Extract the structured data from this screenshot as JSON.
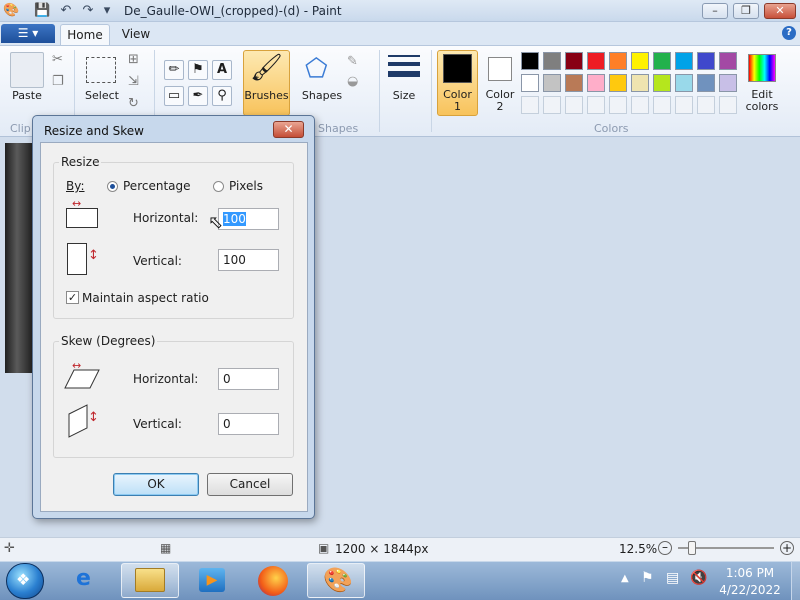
{
  "window": {
    "title": "De_Gaulle-OWI_(cropped)-(d) - Paint",
    "minimize": "–",
    "maximize": "❐",
    "close": "✕"
  },
  "ribbon_tabs": {
    "file": "☰ ▾",
    "home": "Home",
    "view": "View",
    "help": "?"
  },
  "ribbon": {
    "clipboard": {
      "paste": "Paste",
      "group": "Clip"
    },
    "image": {
      "select": "Select"
    },
    "brushes": "Brushes",
    "shapes": {
      "label": "Shapes",
      "group": "Shapes"
    },
    "size": "Size",
    "color1": [
      "Color",
      "1"
    ],
    "color2": [
      "Color",
      "2"
    ],
    "edit_colors": [
      "Edit",
      "colors"
    ],
    "colors_group": "Colors",
    "palette_row1": [
      "#000000",
      "#7f7f7f",
      "#880015",
      "#ed1c24",
      "#ff7f27",
      "#fff200",
      "#22b14c",
      "#00a2e8",
      "#3f48cc",
      "#a349a4"
    ],
    "palette_row2": [
      "#ffffff",
      "#c3c3c3",
      "#b97a57",
      "#ffaec9",
      "#ffc90e",
      "#efe4b0",
      "#b5e61d",
      "#99d9ea",
      "#7092be",
      "#c8bfe7"
    ],
    "empty_swatches": 10
  },
  "dialog": {
    "title": "Resize and Skew",
    "close": "✕",
    "resize": {
      "legend": "Resize",
      "by_label": "By:",
      "percentage": "Percentage",
      "pixels": "Pixels",
      "horizontal_label": "Horizontal:",
      "horizontal_value": "100",
      "vertical_label": "Vertical:",
      "vertical_value": "100",
      "maintain_aspect": "Maintain aspect ratio",
      "maintain_aspect_checked": true,
      "by_selected": "Percentage"
    },
    "skew": {
      "legend": "Skew (Degrees)",
      "horizontal_label": "Horizontal:",
      "horizontal_value": "0",
      "vertical_label": "Vertical:",
      "vertical_value": "0"
    },
    "ok": "OK",
    "cancel": "Cancel"
  },
  "statusbar": {
    "image_size": "1200 × 1844px",
    "zoom": "12.5%",
    "zoom_fraction": 0.1
  },
  "taskbar": {
    "time": "1:06 PM",
    "date": "4/22/2022"
  },
  "colors": {
    "accent": "#1d4f9a",
    "ribbon_bg": "#e3ebf6",
    "workspace": "#d1ddec",
    "highlight": "#3399ff"
  }
}
